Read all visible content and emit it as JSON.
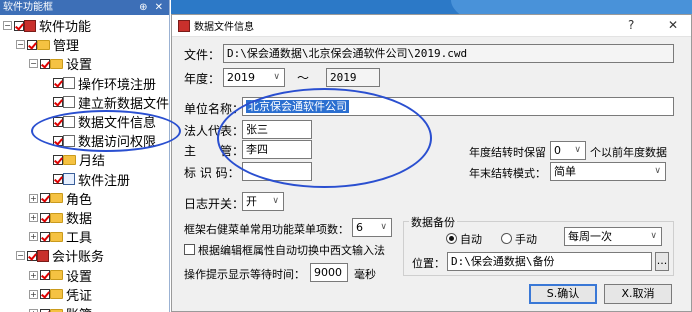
{
  "panel": {
    "title": "软件功能框",
    "pins": "⊕ ✕",
    "tree": [
      {
        "label": "软件功能",
        "level": 0,
        "exp": "−",
        "icon": "red"
      },
      {
        "label": "管理",
        "level": 1,
        "exp": "−",
        "icon": "folder"
      },
      {
        "label": "设置",
        "level": 2,
        "exp": "−",
        "icon": "folder"
      },
      {
        "label": "操作环境注册",
        "level": 3,
        "exp": "",
        "icon": "doc"
      },
      {
        "label": "建立新数据文件",
        "level": 3,
        "exp": "",
        "icon": "doc"
      },
      {
        "label": "数据文件信息",
        "level": 3,
        "exp": "",
        "icon": "doc"
      },
      {
        "label": "数据访问权限",
        "level": 3,
        "exp": "",
        "icon": "doc"
      },
      {
        "label": "月结",
        "level": 3,
        "exp": "",
        "icon": "folder"
      },
      {
        "label": "软件注册",
        "level": 3,
        "exp": "",
        "icon": "cal"
      },
      {
        "label": "角色",
        "level": 2,
        "exp": "+",
        "icon": "folder"
      },
      {
        "label": "数据",
        "level": 2,
        "exp": "+",
        "icon": "folder"
      },
      {
        "label": "工具",
        "level": 2,
        "exp": "+",
        "icon": "folder"
      },
      {
        "label": "会计账务",
        "level": 1,
        "exp": "−",
        "icon": "red"
      },
      {
        "label": "设置",
        "level": 2,
        "exp": "+",
        "icon": "folder"
      },
      {
        "label": "凭证",
        "level": 2,
        "exp": "+",
        "icon": "folder"
      },
      {
        "label": "账簿",
        "level": 2,
        "exp": "+",
        "icon": "folder"
      }
    ]
  },
  "dialog": {
    "title": "数据文件信息",
    "help": "?",
    "close": "✕",
    "file_label": "文件：",
    "file_value": "D:\\保会通数据\\北京保会通软件公司\\2019.cwd",
    "year_label": "年度：",
    "year_from": "2019",
    "year_sep": "～",
    "year_to": "2019",
    "unit_label": "单位名称：",
    "unit_value": "北京保会通软件公司",
    "legal_label": "法人代表：",
    "legal_value": "张三",
    "manager_label": "主　　管：",
    "manager_value": "李四",
    "code_label": "标 识 码：",
    "code_value": "",
    "keep_label": "年度结转时保留",
    "keep_value": "0",
    "keep_suffix": "个以前年度数据",
    "carry_label": "年末结转模式：",
    "carry_value": "简单",
    "log_label": "日志开关：",
    "log_value": "开",
    "menu_label": "框架右健菜单常用功能菜单项数：",
    "menu_value": "6",
    "auto_switch_label": "根据编辑框属性自动切换中西文输入法",
    "wait_label": "操作提示显示等待时间：",
    "wait_value": "9000",
    "wait_unit": "毫秒",
    "backup": {
      "title": "数据备份",
      "auto_label": "自动",
      "manual_label": "手动",
      "freq_value": "每周一次",
      "loc_label": "位置：",
      "loc_value": "D:\\保会通数据\\备份",
      "browse": "..."
    },
    "ok_label": "S.确认",
    "cancel_label": "X.取消"
  }
}
